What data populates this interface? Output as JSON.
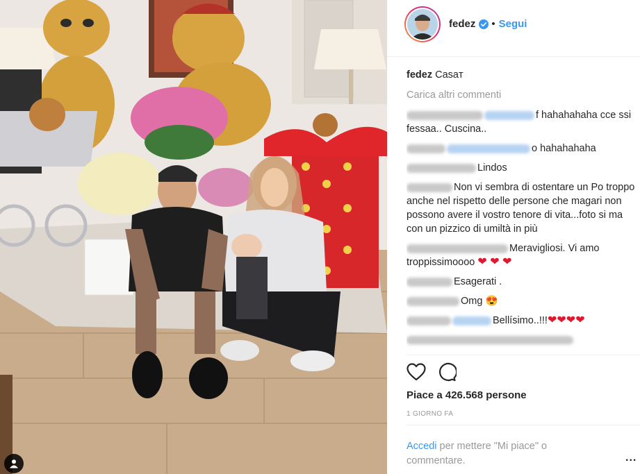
{
  "account": {
    "username": "fedez",
    "dot": "•",
    "follow_label": "Segui"
  },
  "caption": {
    "username": "fedez",
    "text": "Casaᴛ"
  },
  "load_more": "Carica altri commenti",
  "comments": [
    {
      "text": "f hahahahaha cce ssi fessaa.. Cuscina.."
    },
    {
      "text": "o hahahahaha"
    },
    {
      "text": "Lindos"
    },
    {
      "text": "Non vi sembra di ostentare un Po troppo anche nel rispetto delle persone che magari non possono avere il vostro tenore di vita...foto si ma con un pizzico di umiltà in più"
    },
    {
      "text": "Meravigliosi. Vi amo troppissimoooo",
      "emoji": "❤ ❤ ❤"
    },
    {
      "text": "Esagerati ."
    },
    {
      "text": "Omg",
      "emoji": "😍"
    },
    {
      "text": "Bellísimo..!!!",
      "emoji": "❤❤❤❤"
    }
  ],
  "likes": "Piace a 426.568 persone",
  "timestamp": "1 GIORNO FA",
  "login_prompt": {
    "link": "Accedi",
    "text": " per mettere \"Mi piace\" o commentare."
  },
  "more_label": "...",
  "icons": {
    "verified": "verified-badge-icon",
    "like": "heart-outline-icon",
    "comment": "speech-bubble-icon",
    "tag": "person-tag-icon"
  },
  "colors": {
    "link_blue": "#3897f0",
    "muted_gray": "#999999",
    "text": "#262626",
    "divider": "#efefef"
  }
}
